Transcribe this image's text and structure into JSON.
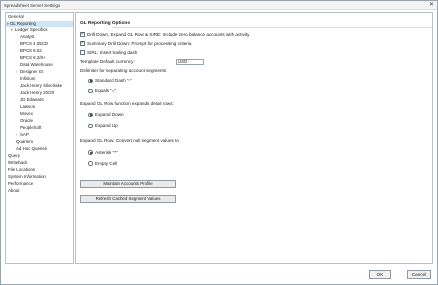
{
  "window": {
    "title": "Spreadsheet Server Settings",
    "close_glyph": "✕"
  },
  "sidebar": {
    "items": [
      {
        "label": "General",
        "toggle": ""
      },
      {
        "label": "GL Reporting",
        "toggle": "▾"
      },
      {
        "label": "Ledger Specifics",
        "toggle": "▾"
      },
      {
        "label": "Analyst",
        "toggle": ""
      },
      {
        "label": "BPCS 4.05CD",
        "toggle": ""
      },
      {
        "label": "BPCS 6.02",
        "toggle": ""
      },
      {
        "label": "BPCS 8.2/8+",
        "toggle": ""
      },
      {
        "label": "Data Warehouse",
        "toggle": ""
      },
      {
        "label": "Designer GI",
        "toggle": "›"
      },
      {
        "label": "Infinium",
        "toggle": ""
      },
      {
        "label": "Jack Henry Silverlake",
        "toggle": ""
      },
      {
        "label": "Jack Henry 20/20",
        "toggle": ""
      },
      {
        "label": "JD Edwards",
        "toggle": ""
      },
      {
        "label": "Lawson",
        "toggle": ""
      },
      {
        "label": "Movex",
        "toggle": ""
      },
      {
        "label": "Oracle",
        "toggle": ""
      },
      {
        "label": "PeopleSoft",
        "toggle": ""
      },
      {
        "label": "SAP",
        "toggle": "›"
      },
      {
        "label": "Quarters",
        "toggle": ""
      },
      {
        "label": "Ad Hoc Queries",
        "toggle": ""
      },
      {
        "label": "Query",
        "toggle": ""
      },
      {
        "label": "Writeback",
        "toggle": ""
      },
      {
        "label": "File Locations",
        "toggle": ""
      },
      {
        "label": "System Information",
        "toggle": ""
      },
      {
        "label": "Performance",
        "toggle": ""
      },
      {
        "label": "About",
        "toggle": ""
      }
    ]
  },
  "main": {
    "heading": "GL Reporting Options",
    "options": {
      "drill_down": "Drill Down, Expand GL Row & SIRE: Include zero balance accounts with activity",
      "summary_drill": "Summary Drill Down: Prompt for processing criteria",
      "sirl_trailing": "SIRL: Insert trailing dash"
    },
    "currency": {
      "label": "Template Default currency",
      "value": "USD"
    },
    "delimiter": {
      "label": "Delimiter for separating account segments",
      "opt1": "Standard Dash \"-\"",
      "opt2": "Equals \"=\""
    },
    "expand_row": {
      "label": "Expand GL Row function expands detail rows:",
      "opt1": "Expand Down",
      "opt2": "Expand Up"
    },
    "convert": {
      "label": "Expand GL Row: Convert null segment values to",
      "opt1": "Asterisk \"*\"",
      "opt2": "Empty Cell"
    },
    "buttons": {
      "maintain": "Maintain Accounts Profile",
      "refresh": "Refresh Cached Segment Values"
    }
  },
  "footer": {
    "ok": "OK",
    "cancel": "Cancel"
  }
}
